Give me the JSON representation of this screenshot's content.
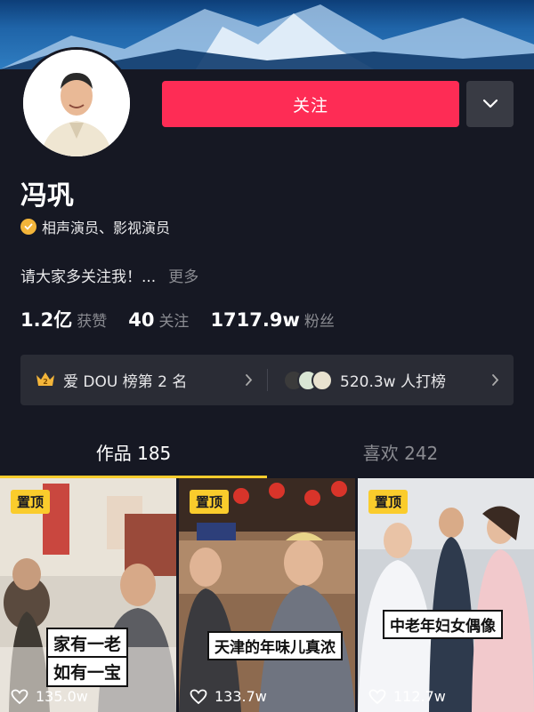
{
  "profile": {
    "name": "冯巩",
    "verification": "相声演员、影视演员",
    "bio": "请大家多关注我！...",
    "bio_more": "更多",
    "follow_label": "关注",
    "stats": [
      {
        "value": "1.2亿",
        "label": "获赞"
      },
      {
        "value": "40",
        "label": "关注"
      },
      {
        "value": "1717.9w",
        "label": "粉丝"
      }
    ],
    "rank": {
      "left_text": "爱 DOU 榜第 2 名",
      "right_text": "520.3w 人打榜"
    }
  },
  "tabs": [
    {
      "label": "作品 185",
      "active": true
    },
    {
      "label": "喜欢 242",
      "active": false
    }
  ],
  "videos": [
    {
      "pin": "置顶",
      "caption_line1": "家有一老",
      "caption_line2": "如有一宝",
      "likes": "135.0w"
    },
    {
      "pin": "置顶",
      "caption_line1": "天津的年味儿真浓",
      "likes": "133.7w"
    },
    {
      "pin": "置顶",
      "caption_line1": "中老年妇女偶像",
      "likes": "112.7w"
    }
  ],
  "colors": {
    "background": "#161823",
    "follow": "#fe2c55",
    "accent_yellow": "#facc2c",
    "muted": "#8a8b91"
  },
  "icons": {
    "more": "chevron-down-icon",
    "verify": "check-badge-icon",
    "crown": "crown-icon",
    "rank_arrow": "chevron-right-icon",
    "like": "heart-outline-icon"
  }
}
